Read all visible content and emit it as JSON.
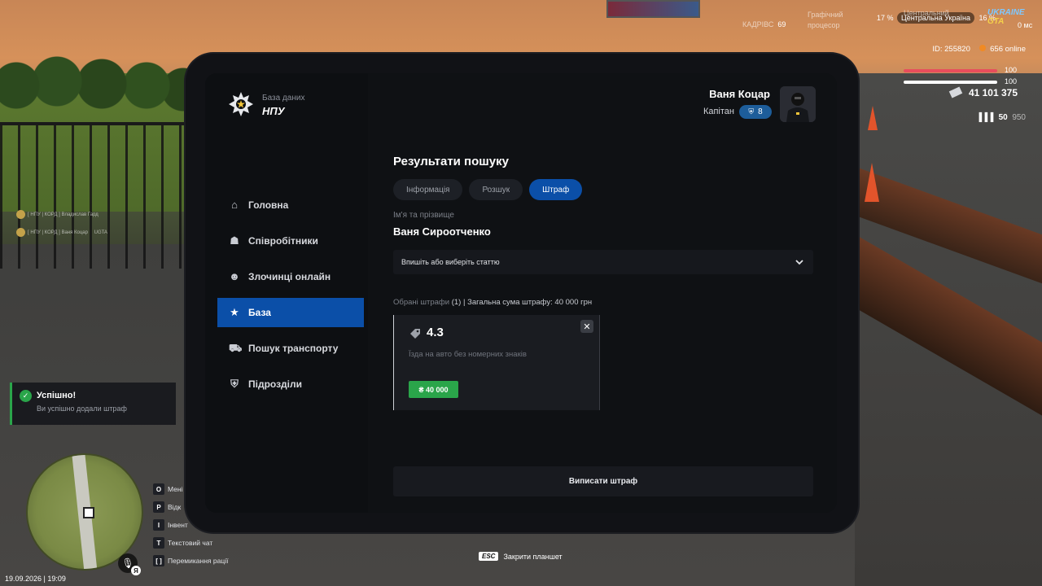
{
  "hud": {
    "top_center_label_1": "КАДРІВС",
    "top_center_value": "69",
    "top_right_label": "Графічний процесор",
    "top_right_label_2": "процесор",
    "region_pct_1": "17 %",
    "region_name": "Центральна Україна",
    "region_label": "Центральний",
    "region_pct_2": "16 %",
    "ping": "0 мс",
    "player_id": "ID: 255820",
    "online": "656 online",
    "health": "100",
    "armor": "100",
    "money": "41 101 375",
    "ammo_current": "50",
    "ammo_total": "950",
    "date_time": "19.09.2026 | 19:09",
    "lang": "Я",
    "colors": {
      "health": "#e84d5c",
      "armor": "#ffffff",
      "accent": "#0b4fa8",
      "success": "#2aa54a"
    }
  },
  "chat": [
    {
      "text": "[ НПУ | КОРД ] Владислав Гард"
    },
    {
      "text": "[ НПУ | КОРД ] Ваня Коцар"
    },
    {
      "text": "UGTA"
    }
  ],
  "tablet": {
    "brand": {
      "subtitle": "База даних",
      "title": "НПУ",
      "icon": "police-star-icon"
    },
    "user": {
      "name": "Ваня Коцар",
      "rank": "Капітан",
      "level": "8"
    },
    "nav": [
      {
        "label": "Головна",
        "icon": "home-icon"
      },
      {
        "label": "Співробітники",
        "icon": "users-icon"
      },
      {
        "label": "Злочинці онлайн",
        "icon": "criminal-icon"
      },
      {
        "label": "База",
        "icon": "star-icon",
        "active": true
      },
      {
        "label": "Пошук транспорту",
        "icon": "car-icon"
      },
      {
        "label": "Підрозділи",
        "icon": "shield-icon"
      }
    ],
    "main": {
      "title": "Результати пошуку",
      "tabs": [
        {
          "label": "Інформація"
        },
        {
          "label": "Розшук"
        },
        {
          "label": "Штраф",
          "active": true
        }
      ],
      "name_label": "Ім'я та прізвище",
      "name_value": "Ваня Сироотченко",
      "select_placeholder": "Впишіть або виберіть статтю",
      "summary_label": "Обрані штрафи",
      "summary_count": "(1)",
      "summary_total": "| Загальна сума штрафу: 40 000 грн",
      "fine": {
        "code": "4.3",
        "description": "Їзда на авто без номерних знаків",
        "amount": "₴ 40 000"
      },
      "submit_label": "Виписати штраф"
    }
  },
  "toast": {
    "title": "Успішно!",
    "text": "Ви успішно додали штраф"
  },
  "keybinds": [
    {
      "key": "O",
      "label": "Мені"
    },
    {
      "key": "P",
      "label": "Відк"
    },
    {
      "key": "I",
      "label": "Інвент"
    },
    {
      "key": "T",
      "label": "Текстовий чат"
    },
    {
      "key": "[  ]",
      "label": "Перемикання рації"
    }
  ],
  "esc_hint": {
    "key": "ESC",
    "label": "Закрити планшет"
  }
}
